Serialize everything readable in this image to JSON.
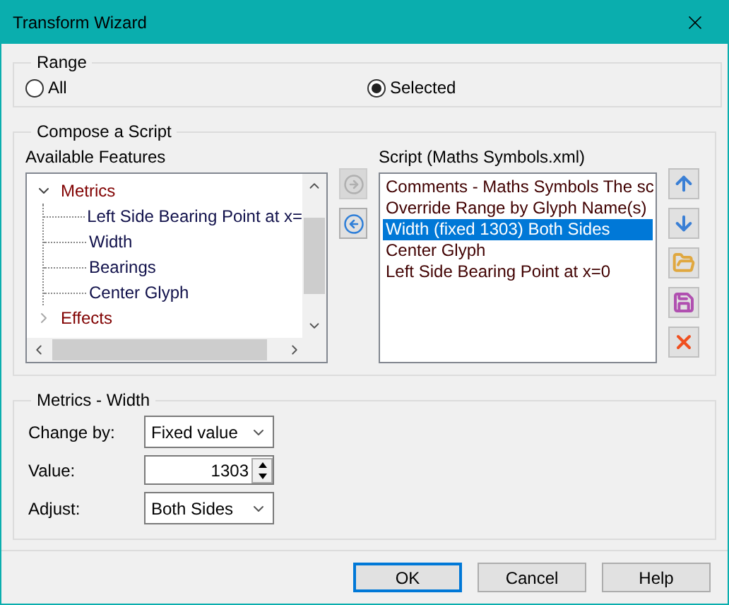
{
  "window": {
    "title": "Transform Wizard"
  },
  "range": {
    "label": "Range",
    "options": [
      {
        "label": "All",
        "selected": false
      },
      {
        "label": "Selected",
        "selected": true
      }
    ]
  },
  "compose": {
    "label": "Compose a Script",
    "features_label": "Available Features",
    "features": [
      {
        "label": "Metrics",
        "expanded": true,
        "children": [
          {
            "label": "Left Side Bearing Point at x="
          },
          {
            "label": "Width"
          },
          {
            "label": "Bearings"
          },
          {
            "label": "Center Glyph"
          }
        ]
      },
      {
        "label": "Effects",
        "expanded": false
      }
    ],
    "transfer_buttons": [
      {
        "kind": "add",
        "disabled": true
      },
      {
        "kind": "remove",
        "disabled": false
      }
    ],
    "script_label": "Script (Maths Symbols.xml)",
    "script": [
      {
        "label": "Comments - Maths Symbols The sc",
        "selected": false
      },
      {
        "label": "Override Range by Glyph Name(s)",
        "selected": false
      },
      {
        "label": "Width (fixed 1303) Both Sides",
        "selected": true
      },
      {
        "label": "Center Glyph",
        "selected": false
      },
      {
        "label": "Left Side Bearing Point at x=0",
        "selected": false
      }
    ],
    "tools": [
      {
        "kind": "up"
      },
      {
        "kind": "down"
      },
      {
        "kind": "open"
      },
      {
        "kind": "save"
      },
      {
        "kind": "delete"
      }
    ]
  },
  "settings": {
    "label": "Metrics - Width",
    "fields": [
      {
        "label": "Change by:",
        "kind": "dropdown",
        "value": "Fixed value"
      },
      {
        "label": "Value:",
        "kind": "spinner",
        "value": "1303"
      },
      {
        "label": "Adjust:",
        "kind": "dropdown",
        "value": "Both Sides"
      }
    ]
  },
  "buttons": [
    {
      "label": "OK",
      "default": true
    },
    {
      "label": "Cancel",
      "default": false
    },
    {
      "label": "Help",
      "default": false
    }
  ]
}
